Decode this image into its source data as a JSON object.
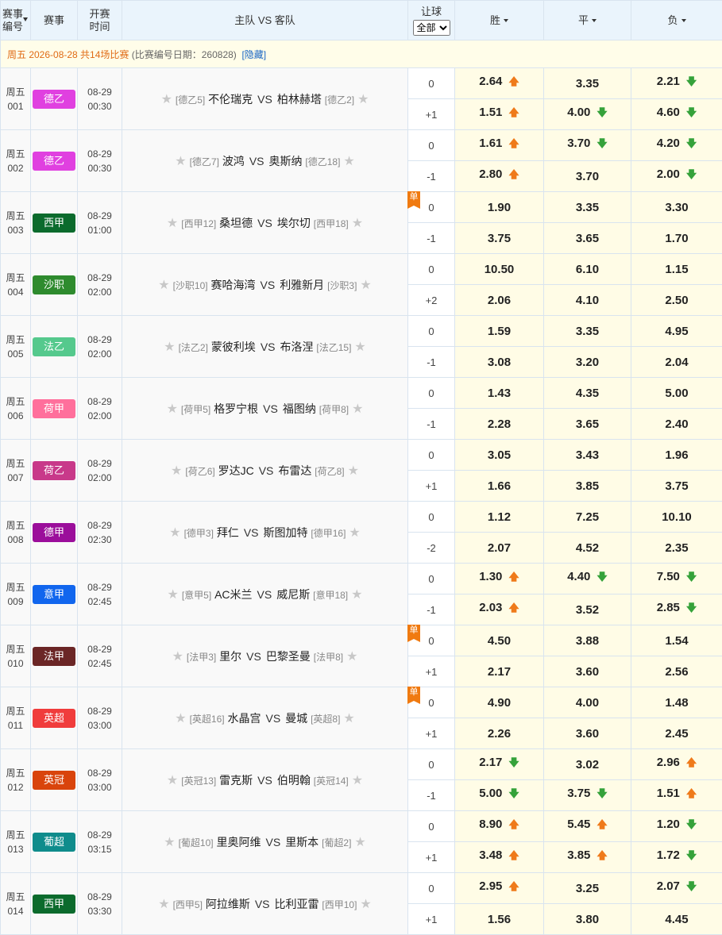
{
  "header": {
    "no_line1": "赛事",
    "no_line2": "编号",
    "league": "赛事",
    "time_line1": "开赛",
    "time_line2": "时间",
    "teams": "主队 VS 客队",
    "handicap": "让球",
    "handicap_select": "全部",
    "win": "胜",
    "draw": "平",
    "lose": "负"
  },
  "dateline": {
    "label": "周五 2026-08-28 共14场比赛",
    "note": "(比赛编号日期：260828)",
    "hide": "[隐藏]"
  },
  "vs_label": "VS",
  "dan_label": "单",
  "matches": [
    {
      "day": "周五",
      "no": "001",
      "league": "德乙",
      "color": "#e040e0",
      "date": "08-29",
      "time": "00:30",
      "home_rank": "[德乙5]",
      "home": "不伦瑞克",
      "away": "柏林赫塔",
      "away_rank": "[德乙2]",
      "dan": false,
      "rows": [
        {
          "hc": "0",
          "w": "2.64",
          "wt": "up",
          "d": "3.35",
          "dt": "",
          "l": "2.21",
          "lt": "down"
        },
        {
          "hc": "+1",
          "w": "1.51",
          "wt": "up",
          "d": "4.00",
          "dt": "down",
          "l": "4.60",
          "lt": "down"
        }
      ]
    },
    {
      "day": "周五",
      "no": "002",
      "league": "德乙",
      "color": "#e040e0",
      "date": "08-29",
      "time": "00:30",
      "home_rank": "[德乙7]",
      "home": "波鸿",
      "away": "奥斯纳",
      "away_rank": "[德乙18]",
      "dan": false,
      "rows": [
        {
          "hc": "0",
          "w": "1.61",
          "wt": "up",
          "d": "3.70",
          "dt": "down",
          "l": "4.20",
          "lt": "down"
        },
        {
          "hc": "-1",
          "w": "2.80",
          "wt": "up",
          "d": "3.70",
          "dt": "",
          "l": "2.00",
          "lt": "down"
        }
      ]
    },
    {
      "day": "周五",
      "no": "003",
      "league": "西甲",
      "color": "#0b6b2d",
      "date": "08-29",
      "time": "01:00",
      "home_rank": "[西甲12]",
      "home": "桑坦德",
      "away": "埃尔切",
      "away_rank": "[西甲18]",
      "dan": true,
      "rows": [
        {
          "hc": "0",
          "w": "1.90",
          "wt": "",
          "d": "3.35",
          "dt": "",
          "l": "3.30",
          "lt": ""
        },
        {
          "hc": "-1",
          "w": "3.75",
          "wt": "",
          "d": "3.65",
          "dt": "",
          "l": "1.70",
          "lt": ""
        }
      ]
    },
    {
      "day": "周五",
      "no": "004",
      "league": "沙职",
      "color": "#2e8b2e",
      "date": "08-29",
      "time": "02:00",
      "home_rank": "[沙职10]",
      "home": "赛哈海湾",
      "away": "利雅新月",
      "away_rank": "[沙职3]",
      "dan": false,
      "rows": [
        {
          "hc": "0",
          "w": "10.50",
          "wt": "",
          "d": "6.10",
          "dt": "",
          "l": "1.15",
          "lt": ""
        },
        {
          "hc": "+2",
          "w": "2.06",
          "wt": "",
          "d": "4.10",
          "dt": "",
          "l": "2.50",
          "lt": ""
        }
      ]
    },
    {
      "day": "周五",
      "no": "005",
      "league": "法乙",
      "color": "#55c98d",
      "date": "08-29",
      "time": "02:00",
      "home_rank": "[法乙2]",
      "home": "蒙彼利埃",
      "away": "布洛涅",
      "away_rank": "[法乙15]",
      "dan": false,
      "rows": [
        {
          "hc": "0",
          "w": "1.59",
          "wt": "",
          "d": "3.35",
          "dt": "",
          "l": "4.95",
          "lt": ""
        },
        {
          "hc": "-1",
          "w": "3.08",
          "wt": "",
          "d": "3.20",
          "dt": "",
          "l": "2.04",
          "lt": ""
        }
      ]
    },
    {
      "day": "周五",
      "no": "006",
      "league": "荷甲",
      "color": "#ff6f9c",
      "date": "08-29",
      "time": "02:00",
      "home_rank": "[荷甲5]",
      "home": "格罗宁根",
      "away": "福图纳",
      "away_rank": "[荷甲8]",
      "dan": false,
      "rows": [
        {
          "hc": "0",
          "w": "1.43",
          "wt": "",
          "d": "4.35",
          "dt": "",
          "l": "5.00",
          "lt": ""
        },
        {
          "hc": "-1",
          "w": "2.28",
          "wt": "",
          "d": "3.65",
          "dt": "",
          "l": "2.40",
          "lt": ""
        }
      ]
    },
    {
      "day": "周五",
      "no": "007",
      "league": "荷乙",
      "color": "#c8398a",
      "date": "08-29",
      "time": "02:00",
      "home_rank": "[荷乙6]",
      "home": "罗达JC",
      "away": "布雷达",
      "away_rank": "[荷乙8]",
      "dan": false,
      "rows": [
        {
          "hc": "0",
          "w": "3.05",
          "wt": "",
          "d": "3.43",
          "dt": "",
          "l": "1.96",
          "lt": ""
        },
        {
          "hc": "+1",
          "w": "1.66",
          "wt": "",
          "d": "3.85",
          "dt": "",
          "l": "3.75",
          "lt": ""
        }
      ]
    },
    {
      "day": "周五",
      "no": "008",
      "league": "德甲",
      "color": "#9b0e9b",
      "date": "08-29",
      "time": "02:30",
      "home_rank": "[德甲3]",
      "home": "拜仁",
      "away": "斯图加特",
      "away_rank": "[德甲16]",
      "dan": false,
      "rows": [
        {
          "hc": "0",
          "w": "1.12",
          "wt": "",
          "d": "7.25",
          "dt": "",
          "l": "10.10",
          "lt": ""
        },
        {
          "hc": "-2",
          "w": "2.07",
          "wt": "",
          "d": "4.52",
          "dt": "",
          "l": "2.35",
          "lt": ""
        }
      ]
    },
    {
      "day": "周五",
      "no": "009",
      "league": "意甲",
      "color": "#1166ee",
      "date": "08-29",
      "time": "02:45",
      "home_rank": "[意甲5]",
      "home": "AC米兰",
      "away": "威尼斯",
      "away_rank": "[意甲18]",
      "dan": false,
      "rows": [
        {
          "hc": "0",
          "w": "1.30",
          "wt": "up",
          "d": "4.40",
          "dt": "down",
          "l": "7.50",
          "lt": "down"
        },
        {
          "hc": "-1",
          "w": "2.03",
          "wt": "up",
          "d": "3.52",
          "dt": "",
          "l": "2.85",
          "lt": "down"
        }
      ]
    },
    {
      "day": "周五",
      "no": "010",
      "league": "法甲",
      "color": "#6b2626",
      "date": "08-29",
      "time": "02:45",
      "home_rank": "[法甲3]",
      "home": "里尔",
      "away": "巴黎圣曼",
      "away_rank": "[法甲8]",
      "dan": true,
      "rows": [
        {
          "hc": "0",
          "w": "4.50",
          "wt": "",
          "d": "3.88",
          "dt": "",
          "l": "1.54",
          "lt": ""
        },
        {
          "hc": "+1",
          "w": "2.17",
          "wt": "",
          "d": "3.60",
          "dt": "",
          "l": "2.56",
          "lt": ""
        }
      ]
    },
    {
      "day": "周五",
      "no": "011",
      "league": "英超",
      "color": "#f03c3c",
      "date": "08-29",
      "time": "03:00",
      "home_rank": "[英超16]",
      "home": "水晶宫",
      "away": "曼城",
      "away_rank": "[英超8]",
      "dan": true,
      "rows": [
        {
          "hc": "0",
          "w": "4.90",
          "wt": "",
          "d": "4.00",
          "dt": "",
          "l": "1.48",
          "lt": ""
        },
        {
          "hc": "+1",
          "w": "2.26",
          "wt": "",
          "d": "3.60",
          "dt": "",
          "l": "2.45",
          "lt": ""
        }
      ]
    },
    {
      "day": "周五",
      "no": "012",
      "league": "英冠",
      "color": "#d9440c",
      "date": "08-29",
      "time": "03:00",
      "home_rank": "[英冠13]",
      "home": "雷克斯",
      "away": "伯明翰",
      "away_rank": "[英冠14]",
      "dan": false,
      "rows": [
        {
          "hc": "0",
          "w": "2.17",
          "wt": "down",
          "d": "3.02",
          "dt": "",
          "l": "2.96",
          "lt": "up"
        },
        {
          "hc": "-1",
          "w": "5.00",
          "wt": "down",
          "d": "3.75",
          "dt": "down",
          "l": "1.51",
          "lt": "up"
        }
      ]
    },
    {
      "day": "周五",
      "no": "013",
      "league": "葡超",
      "color": "#0f8c8c",
      "date": "08-29",
      "time": "03:15",
      "home_rank": "[葡超10]",
      "home": "里奥阿维",
      "away": "里斯本",
      "away_rank": "[葡超2]",
      "dan": false,
      "rows": [
        {
          "hc": "0",
          "w": "8.90",
          "wt": "up",
          "d": "5.45",
          "dt": "up",
          "l": "1.20",
          "lt": "down"
        },
        {
          "hc": "+1",
          "w": "3.48",
          "wt": "up",
          "d": "3.85",
          "dt": "up",
          "l": "1.72",
          "lt": "down"
        }
      ]
    },
    {
      "day": "周五",
      "no": "014",
      "league": "西甲",
      "color": "#0b6b2d",
      "date": "08-29",
      "time": "03:30",
      "home_rank": "[西甲5]",
      "home": "阿拉维斯",
      "away": "比利亚雷",
      "away_rank": "[西甲10]",
      "dan": false,
      "rows": [
        {
          "hc": "0",
          "w": "2.95",
          "wt": "up",
          "d": "3.25",
          "dt": "",
          "l": "2.07",
          "lt": "down"
        },
        {
          "hc": "+1",
          "w": "1.56",
          "wt": "",
          "d": "3.80",
          "dt": "",
          "l": "4.45",
          "lt": ""
        }
      ]
    }
  ]
}
